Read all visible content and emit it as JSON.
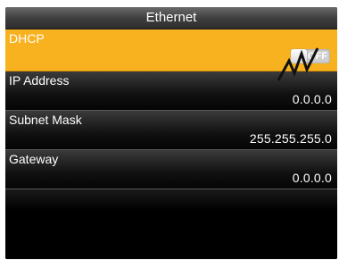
{
  "window": {
    "title": "Ethernet"
  },
  "rows": [
    {
      "label": "DHCP",
      "toggle_state": "OFF"
    },
    {
      "label": "IP Address",
      "value": "0.0.0.0"
    },
    {
      "label": "Subnet Mask",
      "value": "255.255.255.0"
    },
    {
      "label": "Gateway",
      "value": "0.0.0.0"
    }
  ],
  "colors": {
    "selected_row": "#f8b21f",
    "background": "#000000",
    "text": "#ffffff"
  }
}
